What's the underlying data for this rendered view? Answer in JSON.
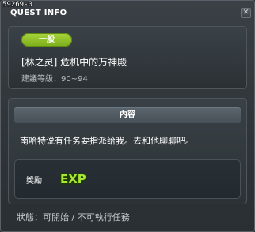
{
  "window": {
    "quest_id": "59269-0",
    "title": "QUEST INFO",
    "close_label": "✕"
  },
  "quest": {
    "category": "一般",
    "name": "[林之灵] 危机中的万神殿",
    "level": "建議等級：90~94"
  },
  "content": {
    "header": "內容",
    "description": "南哈特说有任务要指派给我。去和他聊聊吧。"
  },
  "reward": {
    "label": "獎勵",
    "exp_icon_text": "EXP"
  },
  "status": {
    "text": "狀態：可開始 / 不可執行任務"
  },
  "colors": {
    "badge_green": "#8fc22a",
    "exp_green": "#9ee02a"
  }
}
